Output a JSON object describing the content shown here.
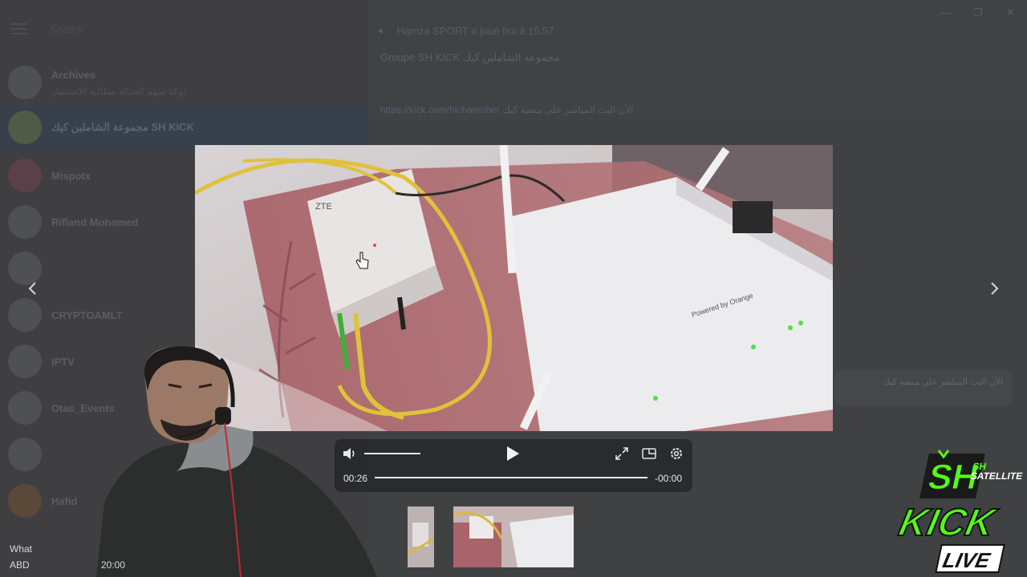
{
  "sidebar": {
    "search_placeholder": "Search",
    "chats": [
      {
        "name": "Archives",
        "preview": "بوكة سهم الحبكة مطالبة الاستثمار"
      },
      {
        "name": "مجموعة الشاملين كيك SH KICK",
        "preview": ""
      },
      {
        "name": "Mispotx",
        "preview": ""
      },
      {
        "name": "Rifland Mohamed",
        "preview": ""
      },
      {
        "name": "",
        "preview": ""
      },
      {
        "name": "CRYPTOAMLT",
        "preview": ""
      },
      {
        "name": "IPTV",
        "preview": ""
      },
      {
        "name": "Otas_Events",
        "preview": ""
      },
      {
        "name": "",
        "preview": ""
      },
      {
        "name": "Hafid",
        "preview": ""
      }
    ]
  },
  "header": {
    "notification": "Hamza SPORT a joué hui à 15:57",
    "group_title": "Groupe SH KICK مجموعة الشاملين كيك",
    "link": "https://kick.com/hichamriber الآن البث المباشر على منصة كيك"
  },
  "bubble": {
    "text": "الآن البث المباشر على منصة كيك"
  },
  "controls": {
    "current_time": "00:26",
    "remaining_time": "-00:00",
    "volume_level": 1.0,
    "progress": 1.0
  },
  "taskbar": {
    "line1": "What",
    "line2": "ABD",
    "time": "20:00"
  },
  "brand": {
    "top": "SH",
    "sub": "SATELLITE",
    "main": "KICK",
    "live": "LIVE"
  },
  "colors": {
    "accent": "#53fc18",
    "panel": "#28292c"
  }
}
